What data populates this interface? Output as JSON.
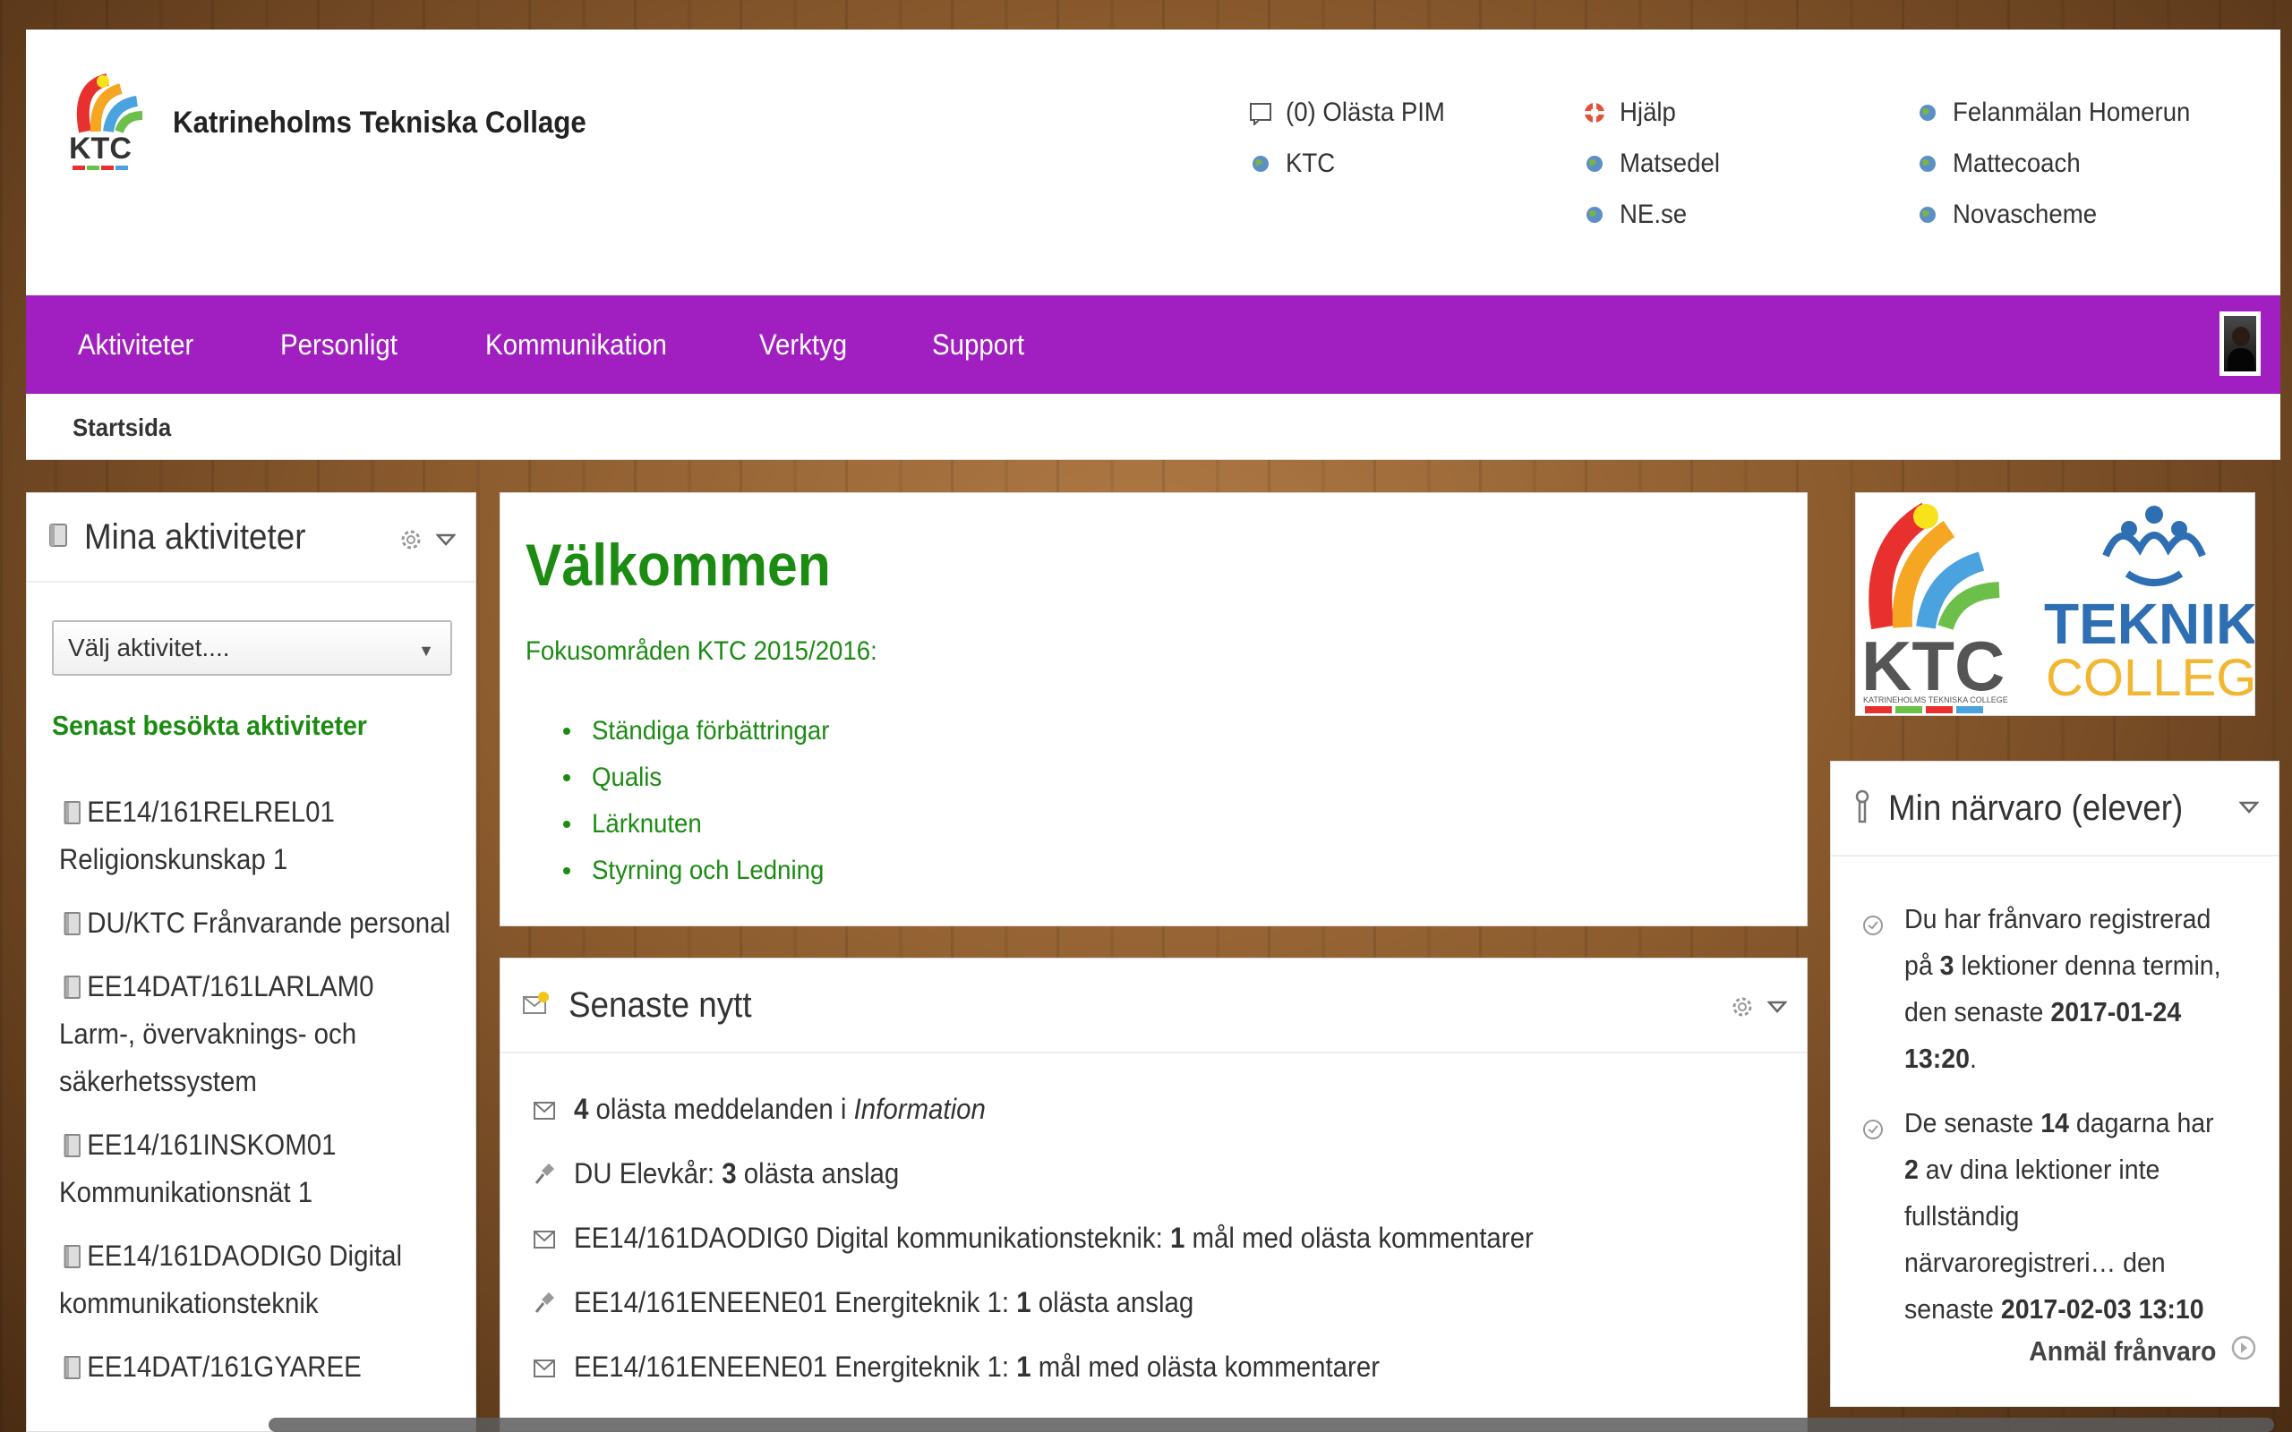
{
  "header": {
    "brand_name": "Katrineholms Tekniska Collage",
    "links_col1": [
      {
        "icon": "message-icon",
        "label": "(0) Olästa PIM"
      },
      {
        "icon": "globe-icon",
        "label": "KTC"
      }
    ],
    "links_col2": [
      {
        "icon": "lifebuoy-icon",
        "label": "Hjälp"
      },
      {
        "icon": "globe-icon",
        "label": "Matsedel"
      },
      {
        "icon": "globe-icon",
        "label": "NE.se"
      }
    ],
    "links_col3": [
      {
        "icon": "globe-icon",
        "label": "Felanmälan Homerun"
      },
      {
        "icon": "globe-icon",
        "label": "Mattecoach"
      },
      {
        "icon": "globe-icon",
        "label": "Novascheme"
      }
    ]
  },
  "nav": {
    "items": [
      "Aktiviteter",
      "Personligt",
      "Kommunikation",
      "Verktyg",
      "Support"
    ]
  },
  "breadcrumb": "Startsida",
  "my_activities": {
    "title": "Mina aktiviteter",
    "select_value": "Välj aktivitet....",
    "recent_heading": "Senast besökta aktiviteter",
    "items": [
      "EE14/161RELREL01 Religionskunskap 1",
      "DU/KTC Frånvarande personal",
      "EE14DAT/161LARLAM0 Larm-, övervaknings- och säkerhetssystem",
      "EE14/161INSKOM01 Kommunikationsnät 1",
      "EE14/161DAODIG0 Digital kommunikationsteknik",
      "EE14DAT/161GYAREE"
    ]
  },
  "welcome": {
    "title": "Välkommen",
    "focus_label": "Fokusområden KTC 2015/2016:",
    "focus_items": [
      "Ständiga förbättringar",
      "Qualis",
      "Lärknuten",
      "Styrning och Ledning"
    ]
  },
  "news": {
    "title": "Senaste nytt",
    "items": [
      {
        "icon": "envelope-icon",
        "n": "4",
        "pre": "",
        "post": " olästa meddelanden i ",
        "italic": "Information"
      },
      {
        "icon": "pin-icon",
        "n": "3",
        "pre": "DU Elevkår: ",
        "post": " olästa anslag",
        "italic": ""
      },
      {
        "icon": "envelope-icon",
        "n": "1",
        "pre": "EE14/161DAODIG0 Digital kommunikationsteknik: ",
        "post": " mål med olästa kommentarer",
        "italic": ""
      },
      {
        "icon": "pin-icon",
        "n": "1",
        "pre": "EE14/161ENEENE01 Energiteknik 1: ",
        "post": " olästa anslag",
        "italic": ""
      },
      {
        "icon": "envelope-icon",
        "n": "1",
        "pre": "EE14/161ENEENE01 Energiteknik 1: ",
        "post": " mål med olästa kommentarer",
        "italic": ""
      }
    ]
  },
  "logo": {
    "ktc_text": "KTC",
    "ktc_subtext": "KATRINEHOLMS TEKNISKA COLLEGE",
    "teknik_text": "TEKNIK",
    "college_text": "COLLEGE"
  },
  "attendance": {
    "title": "Min närvaro (elever)",
    "p1_a": "Du har frånvaro registrerad på ",
    "p1_n": "3",
    "p1_b": " lektioner denna termin, den senaste ",
    "p1_date": "2017-01-24 13:20",
    "p1_c": ".",
    "p2_a": "De senaste ",
    "p2_n1": "14",
    "p2_b": " dagarna har ",
    "p2_n2": "2",
    "p2_c": " av dina lektioner inte fullständig närvaroregistreri… den senaste ",
    "p2_date": "2017-02-03 13:10",
    "report_label": "Anmäl frånvaro"
  },
  "colors": {
    "nav_purple": "#a11fc1",
    "accent_green": "#1b8b12"
  }
}
